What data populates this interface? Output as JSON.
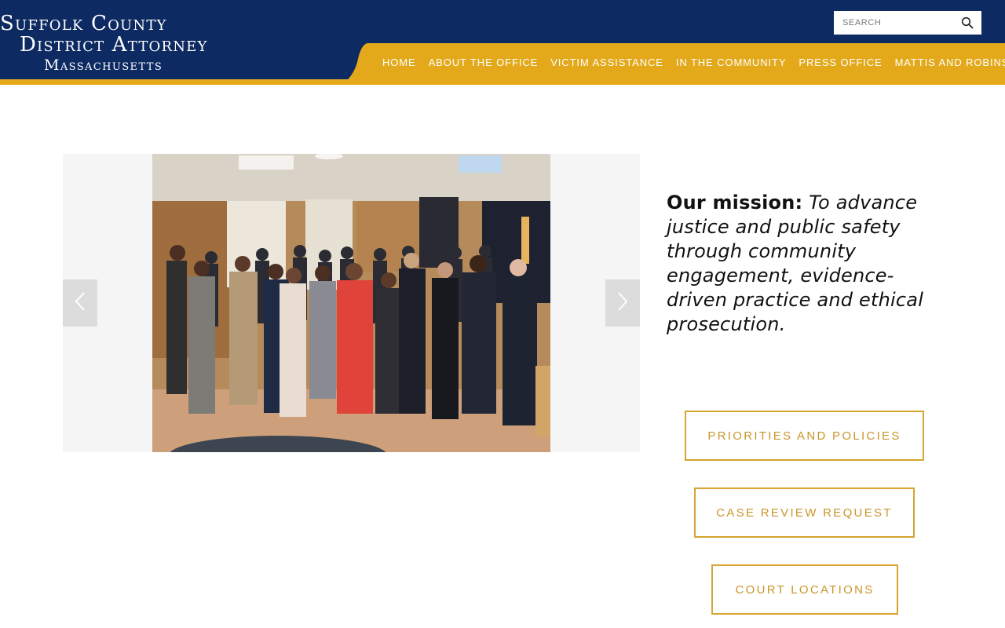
{
  "brand": {
    "line1": "Suffolk County",
    "line2": "District Attorney",
    "line3": "Massachusetts",
    "colors": {
      "navy": "#0d2a62",
      "gold": "#e3a91b",
      "button_text": "#c9962a"
    }
  },
  "search": {
    "placeholder": "SEARCH",
    "icon": "search-icon"
  },
  "nav": {
    "items": [
      {
        "label": "HOME"
      },
      {
        "label": "ABOUT THE OFFICE"
      },
      {
        "label": "VICTIM ASSISTANCE"
      },
      {
        "label": "IN THE COMMUNITY"
      },
      {
        "label": "PRESS OFFICE"
      },
      {
        "label": "MATTIS AND ROBINSON"
      }
    ]
  },
  "carousel": {
    "prev_icon": "chevron-left-icon",
    "next_icon": "chevron-right-icon"
  },
  "mission": {
    "lead": "Our mission:",
    "text": "To advance justice and public safety through community engagement, evidence-driven practice and ethical prosecution."
  },
  "actions": {
    "priorities": "PRIORITIES AND POLICIES",
    "case_review": "CASE REVIEW REQUEST",
    "court_locations": "COURT LOCATIONS"
  }
}
